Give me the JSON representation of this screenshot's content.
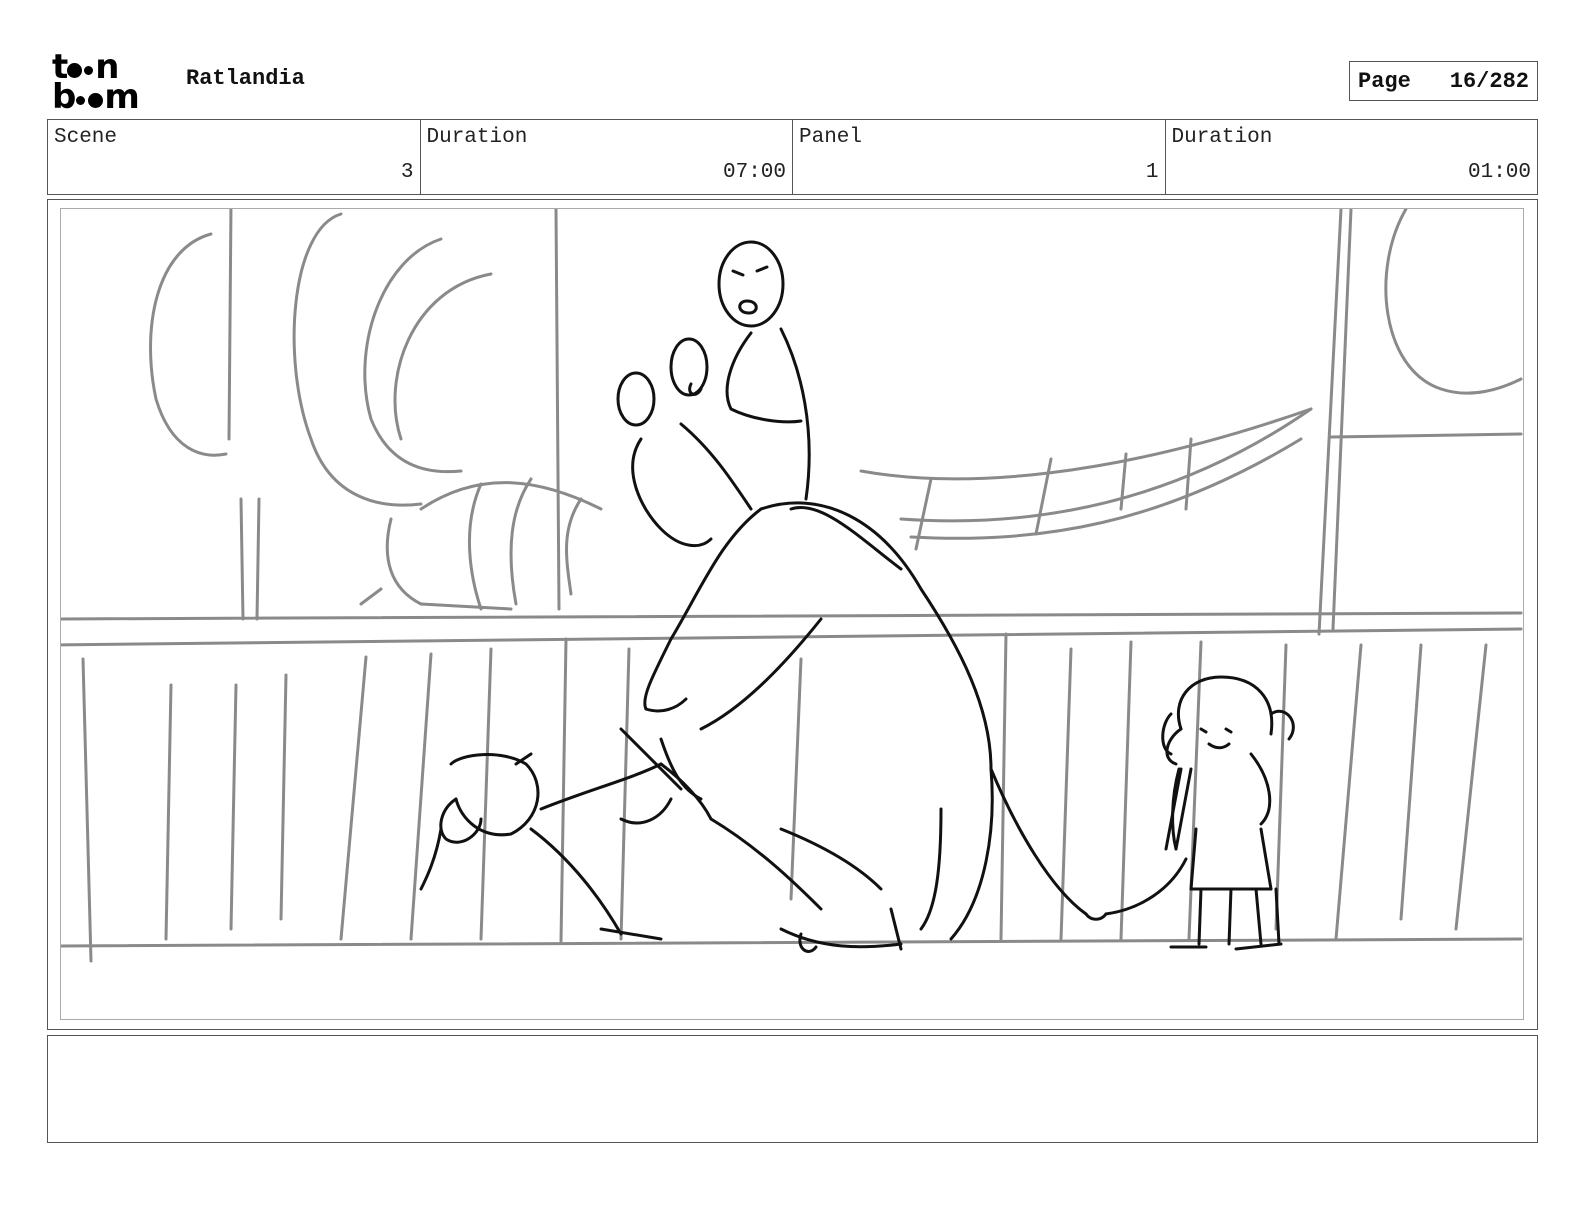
{
  "header": {
    "logo_text": "toon boom",
    "project_title": "Ratlandia",
    "page_label": "Page",
    "page_number": "16/282"
  },
  "info": {
    "scene_label": "Scene",
    "scene_value": "3",
    "scene_duration_label": "Duration",
    "scene_duration_value": "07:00",
    "panel_label": "Panel",
    "panel_value": "1",
    "panel_duration_label": "Duration",
    "panel_duration_value": "01:00"
  },
  "notes": {
    "text": ""
  }
}
